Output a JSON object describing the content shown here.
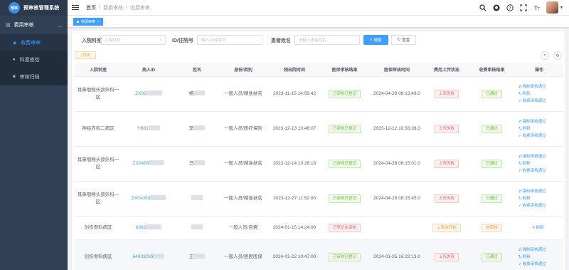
{
  "app": {
    "logo_text": "预审",
    "title": "预审核管理系统"
  },
  "sidebar": {
    "group": {
      "label": "费用审核"
    },
    "items": [
      {
        "label": "收费审审",
        "active": true
      },
      {
        "label": "科室查验",
        "active": false
      },
      {
        "label": "审核归档",
        "active": false
      }
    ]
  },
  "navbar": {
    "breadcrumb": [
      "首页",
      "费用审核",
      "收费审审"
    ],
    "icons": [
      "search-icon",
      "github-icon",
      "question-icon",
      "fullscreen-icon",
      "font-size-icon"
    ]
  },
  "tagsbar": {
    "active_tag": "收费审审"
  },
  "filters": {
    "dept_label": "入院科室",
    "dept_placeholder": "入院科室",
    "id_label": "ID/住院号",
    "id_placeholder": "输入ID/住院号",
    "name_label": "患者姓名",
    "name_placeholder": "请输入患者姓名",
    "search_btn": "搜索",
    "reset_btn": "重置"
  },
  "toolbar": {
    "export_btn": "导出"
  },
  "table": {
    "headers": [
      "入院科室",
      "病人ID",
      "姓名",
      "身份/类别",
      "预出院时间",
      "医保审核结果",
      "医保审核时间",
      "费用上传状态",
      "收费审核结果",
      "操作"
    ],
    "rows": [
      {
        "dept": "耳鼻咽喉头颈外科一区",
        "pid": "ZX03",
        "name": "杨",
        "cat": "一般人员/精准扶贫",
        "pre": "2023-11-15 14:56:42",
        "ins": "已审核已登记",
        "ins_c": "green",
        "ins_time": "2024-04-28 08:13:49.0",
        "up": "上传失败",
        "up_c": "red",
        "fee": "已通过",
        "fee_c": "green",
        "ops": [
          "强制审核通过",
          "刷新",
          "收费审核通过"
        ]
      },
      {
        "dept": "神经内科二病区",
        "pid": "YB01",
        "name": "李",
        "cat": "一般人员/医疗保险",
        "pre": "2023-12-13 10:46:07",
        "ins": "已审核已登记",
        "ins_c": "green",
        "ins_time": "2023-12-12 10:33:38.0",
        "up": "上传失败",
        "up_c": "red",
        "fee": "已通过",
        "fee_c": "green",
        "ops": [
          "强制审核通过",
          "刷新",
          "收费审核通过"
        ]
      },
      {
        "dept": "耳鼻咽喉头颈外科一区",
        "pid": "ZX0428",
        "name": "马",
        "cat": "一般人员/精准扶贫",
        "pre": "2023-12-14 10:26:18",
        "ins": "已审核已登记",
        "ins_c": "green",
        "ins_time": "2024-04-28 08:15:01.0",
        "up": "上传失败",
        "up_c": "red",
        "fee": "已通过",
        "fee_c": "green",
        "ops": [
          "强制审核通过",
          "刷新",
          "收费审核通过"
        ]
      },
      {
        "dept": "耳鼻咽喉头颈外科一区",
        "pid": "ZX04353",
        "name": "",
        "cat": "一般人员/精准扶贫",
        "pre": "2023-12-27 11:52:00",
        "ins": "已审核已登记",
        "ins_c": "green",
        "ins_time": "2024-04-28 08:15:45.0",
        "up": "上传失败",
        "up_c": "red",
        "fee": "已通过",
        "fee_c": "green",
        "ops": [
          "强制审核通过",
          "刷新",
          "收费审核通过"
        ]
      },
      {
        "dept": "创伤骨科病区",
        "pid": "6362",
        "name": "",
        "cat": "一般人员/自费",
        "pre": "2024-01-15 14:24:00",
        "ins": "已登记未审核",
        "ins_c": "red",
        "ins_time": "",
        "up": "上传未开始",
        "up_c": "orange",
        "fee": "未审核",
        "fee_c": "orange",
        "ops": [
          "刷新"
        ]
      },
      {
        "dept": "创伤骨科病区",
        "pid": "64933289",
        "name": "王",
        "cat": "一般人员/居民医保",
        "pre": "2024-01-22 10:47:00",
        "ins": "已审核已登记",
        "ins_c": "green",
        "ins_time": "2024-01-25 16:22:13.0",
        "up": "上传失败",
        "up_c": "red",
        "fee": "已通过",
        "fee_c": "green",
        "ops": [
          "强制审核通过",
          "刷新",
          "收费审核通过"
        ]
      }
    ]
  }
}
